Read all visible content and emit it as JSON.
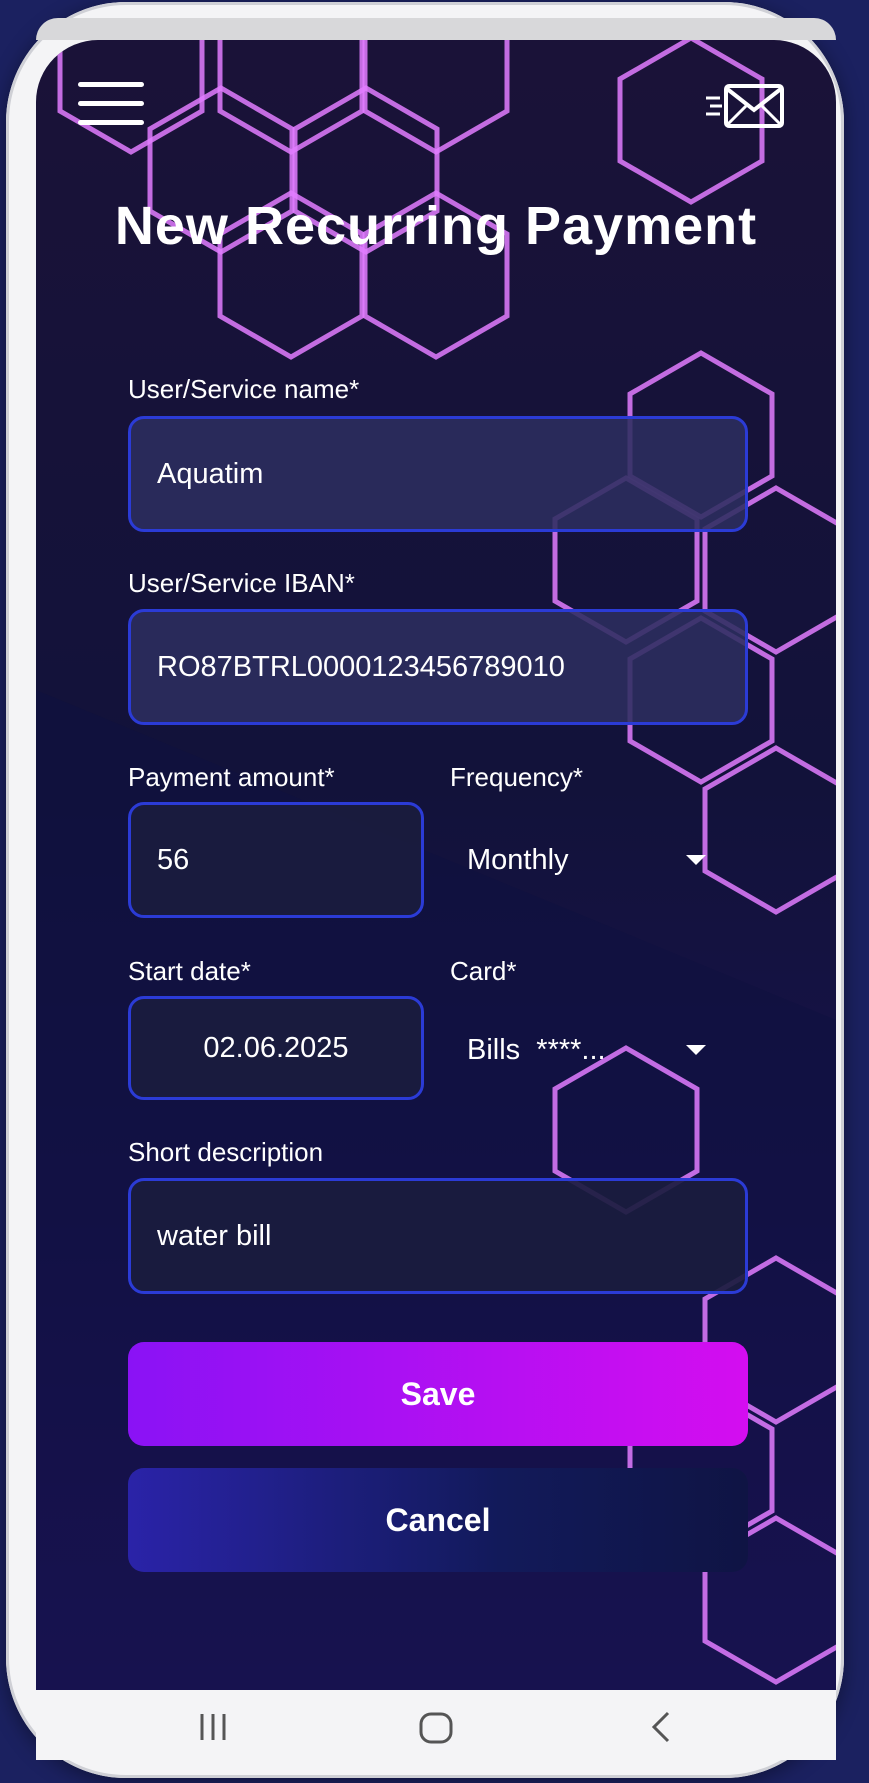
{
  "header": {
    "title": "New Recurring Payment",
    "menu_icon": "hamburger-menu-icon",
    "mail_icon": "send-mail-icon"
  },
  "form": {
    "name": {
      "label": "User/Service name*",
      "value": "Aquatim"
    },
    "iban": {
      "label": "User/Service IBAN*",
      "value": "RO87BTRL0000123456789010"
    },
    "amount": {
      "label": "Payment amount*",
      "value": "56"
    },
    "frequency": {
      "label": "Frequency*",
      "value": "Monthly"
    },
    "start_date": {
      "label": "Start date*",
      "value": "02.06.2025"
    },
    "card": {
      "label": "Card*",
      "value": "Bills  ****..."
    },
    "description": {
      "label": "Short description",
      "value": "water bill"
    }
  },
  "actions": {
    "save_label": "Save",
    "cancel_label": "Cancel"
  },
  "navbar": {
    "recents_icon": "recent-apps-icon",
    "home_icon": "home-icon",
    "back_icon": "back-icon"
  },
  "colors": {
    "accent_start": "#8a12f5",
    "accent_end": "#d40df0",
    "field_border": "#2b3bd6",
    "hex_glow": "#e27cff"
  }
}
